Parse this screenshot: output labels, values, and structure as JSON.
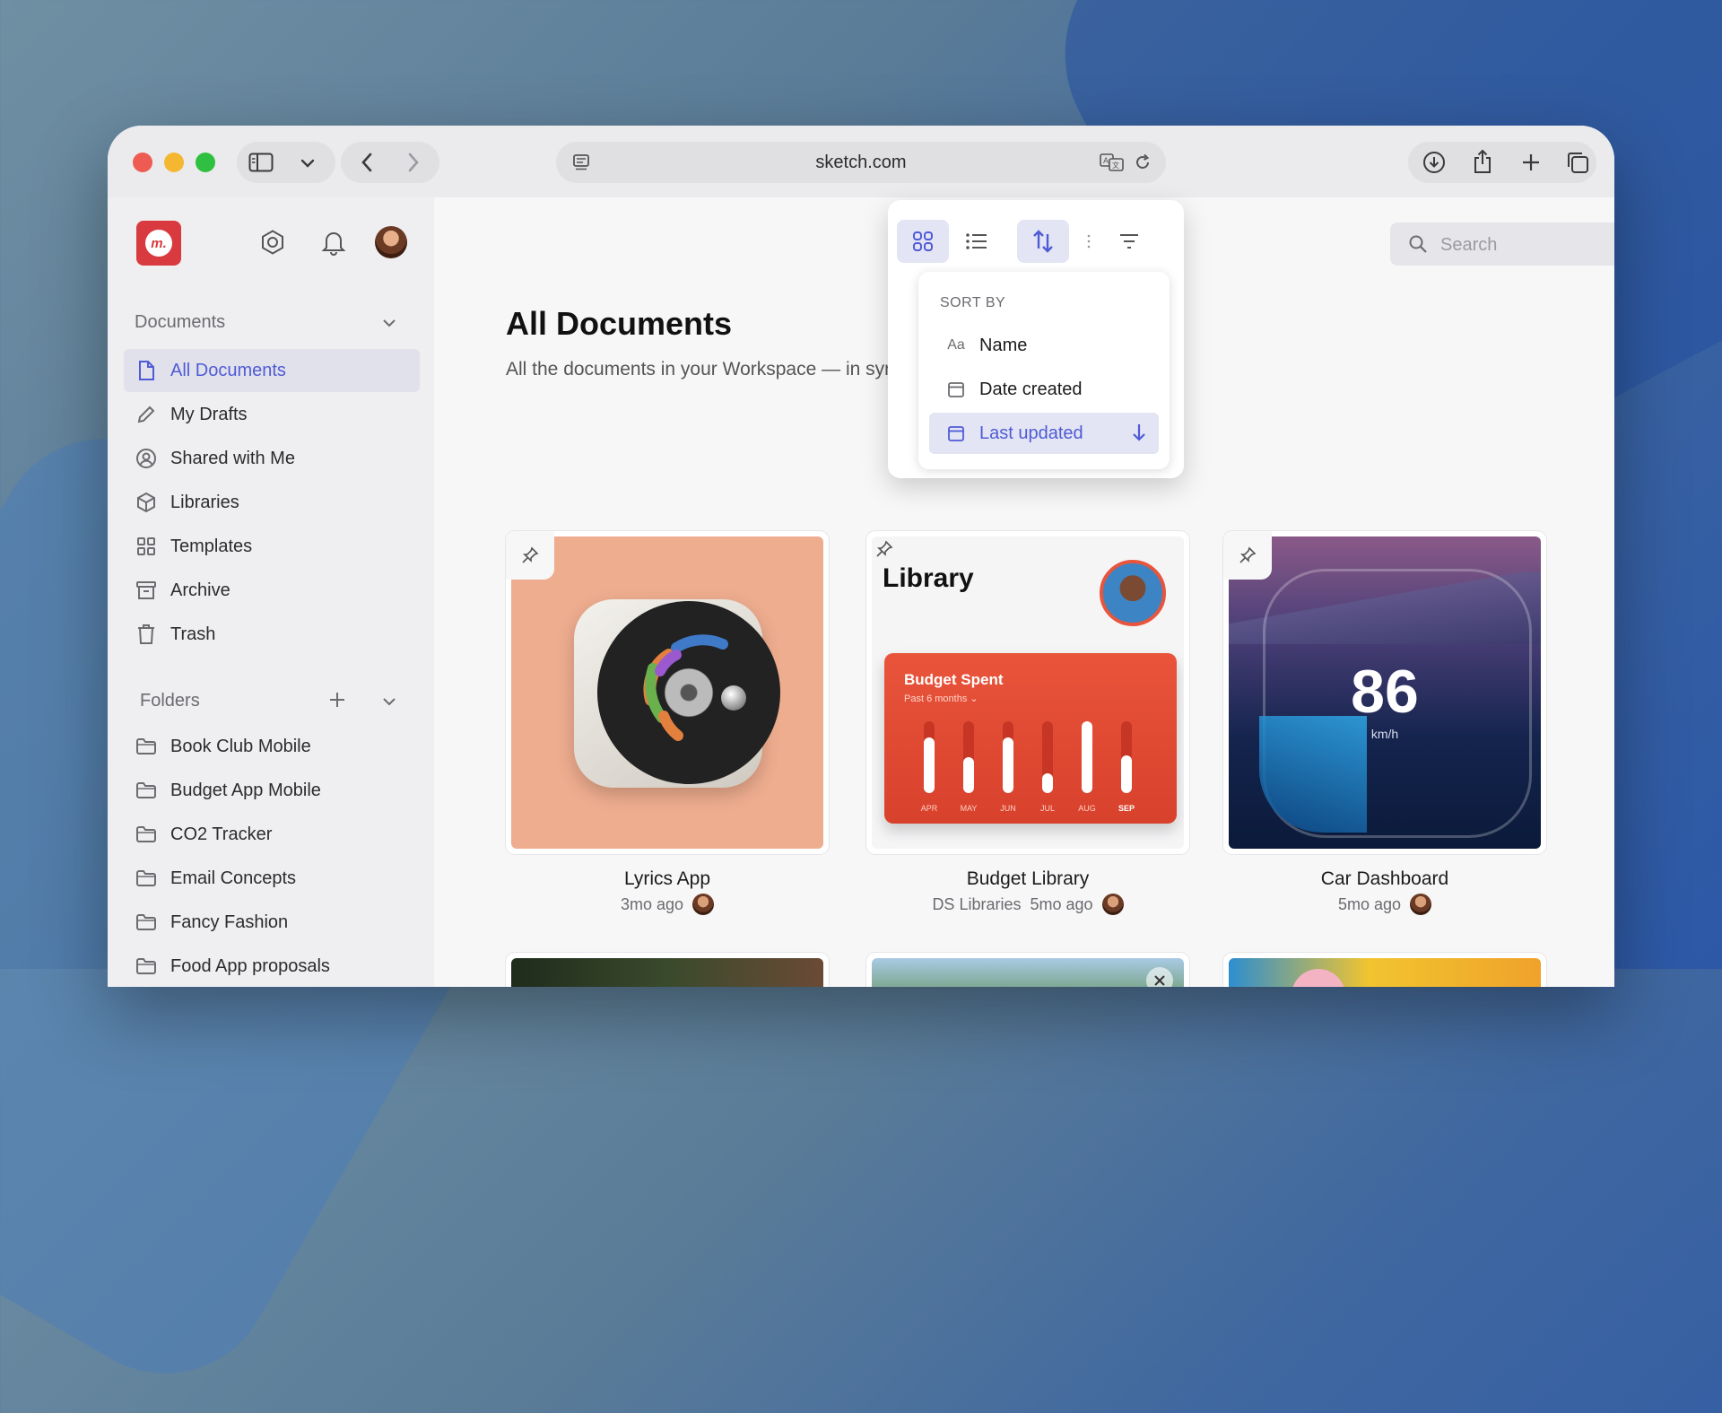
{
  "browser": {
    "url": "sketch.com",
    "colors": {
      "close": "#ee5b52",
      "minimize": "#f5b731",
      "maximize": "#2fc041"
    }
  },
  "sidebar": {
    "documents_header": "Documents",
    "items": [
      {
        "label": "All Documents",
        "icon": "document-icon",
        "active": true
      },
      {
        "label": "My Drafts",
        "icon": "pencil-icon"
      },
      {
        "label": "Shared with Me",
        "icon": "person-circle-icon"
      },
      {
        "label": "Libraries",
        "icon": "cube-icon"
      },
      {
        "label": "Templates",
        "icon": "templates-icon"
      },
      {
        "label": "Archive",
        "icon": "archive-icon"
      },
      {
        "label": "Trash",
        "icon": "trash-icon"
      }
    ],
    "folders_header": "Folders",
    "folders": [
      {
        "label": "Book Club Mobile"
      },
      {
        "label": "Budget App Mobile"
      },
      {
        "label": "CO2 Tracker"
      },
      {
        "label": "Email Concepts"
      },
      {
        "label": "Fancy Fashion"
      },
      {
        "label": "Food App proposals"
      }
    ]
  },
  "main": {
    "title": "All Documents",
    "subtitle": "All the documents in your Workspace — in syr",
    "help": "?",
    "search_placeholder": "Search",
    "accent": "#4f5bd5"
  },
  "sort_menu": {
    "header": "SORT BY",
    "options": [
      {
        "label": "Name",
        "icon": "Aa"
      },
      {
        "label": "Date created",
        "icon": "calendar-icon"
      },
      {
        "label": "Last updated",
        "icon": "calendar-icon",
        "selected": true
      }
    ]
  },
  "cards": [
    {
      "title": "Lyrics App",
      "library": "",
      "time": "3mo ago"
    },
    {
      "title": "Budget Library",
      "library": "DS Libraries",
      "time": "5mo ago",
      "thumb": {
        "heading": "Library",
        "widget_title": "Budget Spent",
        "widget_sub": "Past 6 months ⌄",
        "months": [
          "APR",
          "MAY",
          "JUN",
          "JUL",
          "AUG",
          "SEP"
        ]
      }
    },
    {
      "title": "Car Dashboard",
      "library": "",
      "time": "5mo ago",
      "thumb": {
        "speed": "86",
        "unit": "km/h"
      }
    }
  ]
}
